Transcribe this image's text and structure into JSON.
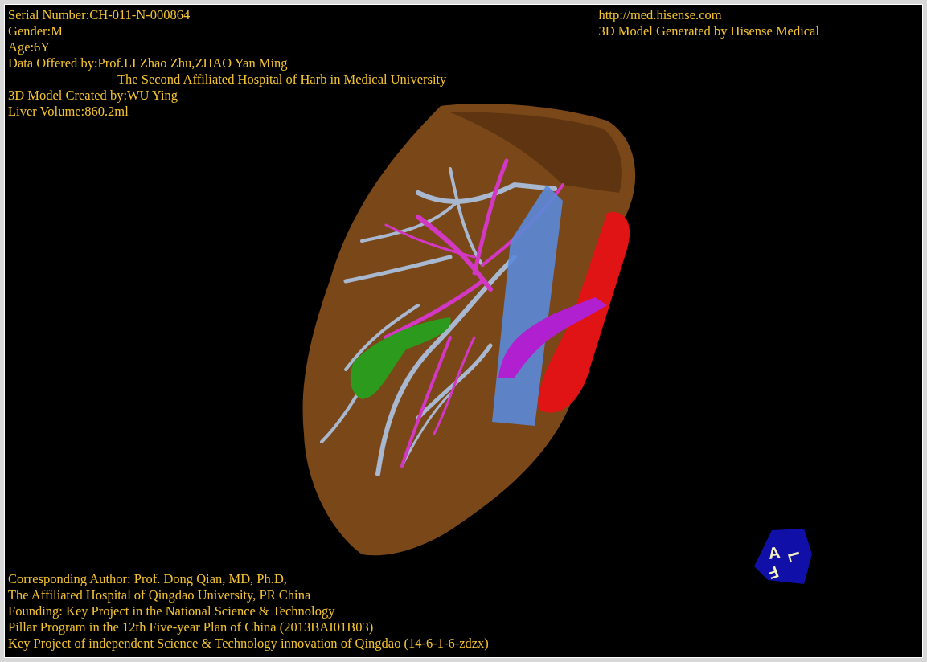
{
  "info_top_left": [
    {
      "kind": "line",
      "text": "Serial Number:CH-011-N-000864"
    },
    {
      "kind": "line",
      "text": "Gender:M"
    },
    {
      "kind": "line",
      "text": "Age:6Y"
    },
    {
      "kind": "line",
      "text": "Data Offered by:Prof.LI Zhao Zhu,ZHAO Yan Ming"
    },
    {
      "kind": "continuation",
      "text": "The Second Affiliated Hospital of Harb in Medical University"
    },
    {
      "kind": "line",
      "text": "3D Model Created by:WU Ying"
    },
    {
      "kind": "line",
      "text": "Liver Volume:860.2ml"
    }
  ],
  "info_top_right": [
    {
      "kind": "line",
      "text": "http://med.hisense.com"
    },
    {
      "kind": "line",
      "text": "3D Model Generated by Hisense Medical"
    }
  ],
  "info_bottom_left": [
    {
      "kind": "line",
      "text": "Corresponding Author: Prof. Dong Qian, MD, Ph.D,"
    },
    {
      "kind": "line",
      "text": "The Affiliated Hospital of Qingdao University, PR China"
    },
    {
      "kind": "line",
      "text": "Founding: Key Project in the National Science & Technology"
    },
    {
      "kind": "line",
      "text": "Pillar Program in the 12th Five-year Plan of China (2013BAI01B03)"
    },
    {
      "kind": "line",
      "text": "Key Project of independent Science & Technology innovation of Qingdao (14-6-1-6-zdzx)"
    }
  ],
  "orientation_cube": {
    "labels": [
      "A",
      "L",
      "F"
    ]
  }
}
